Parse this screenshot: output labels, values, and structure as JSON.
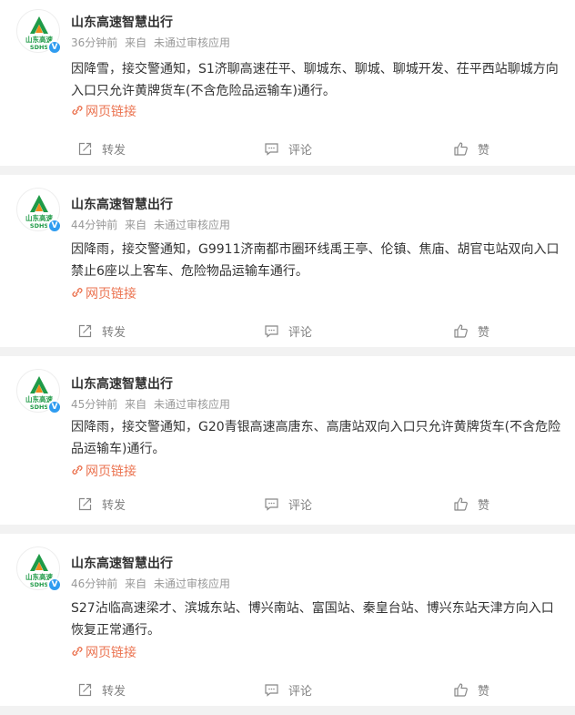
{
  "feed": {
    "posts": [
      {
        "author": "山东高速智慧出行",
        "time": "36分钟前",
        "source_prefix": "来自",
        "source": "未通过审核应用",
        "text": "因降雪，接交警通知，S1济聊高速茌平、聊城东、聊城、聊城开发、茌平西站聊城方向入口只允许黄牌货车(不含危险品运输车)通行。",
        "link_label": "网页链接",
        "repost_label": "转发",
        "comment_label": "评论",
        "like_label": "赞"
      },
      {
        "author": "山东高速智慧出行",
        "time": "44分钟前",
        "source_prefix": "来自",
        "source": "未通过审核应用",
        "text": "因降雨，接交警通知，G9911济南都市圈环线禹王亭、伦镇、焦庙、胡官屯站双向入口禁止6座以上客车、危险物品运输车通行。",
        "link_label": "网页链接",
        "repost_label": "转发",
        "comment_label": "评论",
        "like_label": "赞"
      },
      {
        "author": "山东高速智慧出行",
        "time": "45分钟前",
        "source_prefix": "来自",
        "source": "未通过审核应用",
        "text": "因降雨，接交警通知，G20青银高速高唐东、高唐站双向入口只允许黄牌货车(不含危险品运输车)通行。",
        "link_label": "网页链接",
        "repost_label": "转发",
        "comment_label": "评论",
        "like_label": "赞"
      },
      {
        "author": "山东高速智慧出行",
        "time": "46分钟前",
        "source_prefix": "来自",
        "source": "未通过审核应用",
        "text": "S27沾临高速梁才、滨城东站、博兴南站、富国站、秦皇台站、博兴东站天津方向入口恢复正常通行。",
        "link_label": "网页链接",
        "repost_label": "转发",
        "comment_label": "评论",
        "like_label": "赞"
      }
    ]
  },
  "avatar": {
    "logo_text_cn": "山东高速",
    "logo_text_en": "SDHS",
    "verified_mark": "V"
  },
  "colors": {
    "link": "#eb7350",
    "meta": "#999999",
    "verified": "#2f9cf0",
    "logo_green": "#1f9a47",
    "logo_orange": "#f08a1c"
  }
}
